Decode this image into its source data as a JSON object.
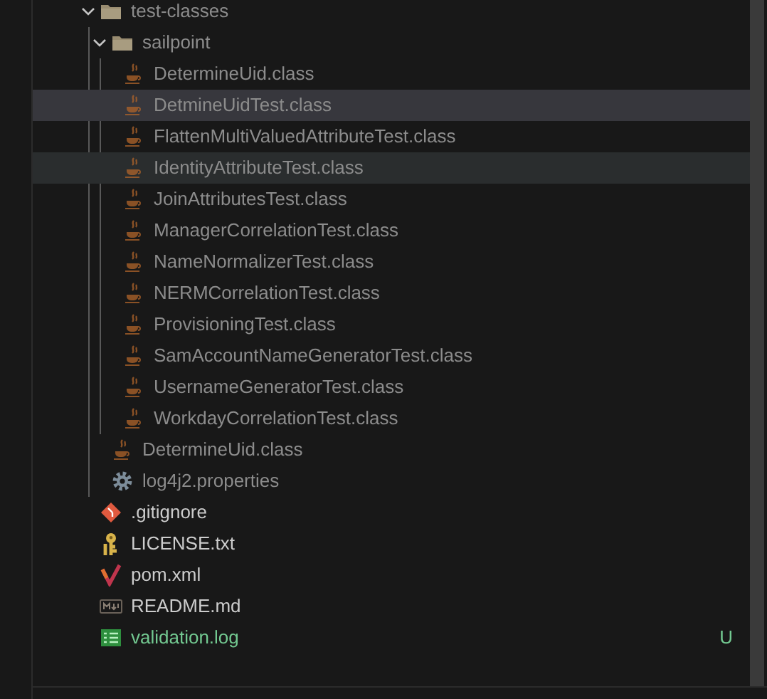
{
  "explorer": {
    "tree": [
      {
        "label": "test-classes",
        "kind": "folder",
        "expanded": true,
        "ignored": true,
        "selected": false,
        "hovered": false,
        "children": [
          {
            "label": "sailpoint",
            "kind": "folder",
            "expanded": true,
            "ignored": true,
            "selected": false,
            "hovered": false,
            "children": [
              {
                "label": "DetermineUid.class",
                "kind": "java",
                "ignored": true,
                "selected": false,
                "hovered": false
              },
              {
                "label": "DetmineUidTest.class",
                "kind": "java",
                "ignored": true,
                "selected": true,
                "hovered": false
              },
              {
                "label": "FlattenMultiValuedAttributeTest.class",
                "kind": "java",
                "ignored": true,
                "selected": false,
                "hovered": false
              },
              {
                "label": "IdentityAttributeTest.class",
                "kind": "java",
                "ignored": true,
                "selected": false,
                "hovered": true
              },
              {
                "label": "JoinAttributesTest.class",
                "kind": "java",
                "ignored": true,
                "selected": false,
                "hovered": false
              },
              {
                "label": "ManagerCorrelationTest.class",
                "kind": "java",
                "ignored": true,
                "selected": false,
                "hovered": false
              },
              {
                "label": "NameNormalizerTest.class",
                "kind": "java",
                "ignored": true,
                "selected": false,
                "hovered": false
              },
              {
                "label": "NERMCorrelationTest.class",
                "kind": "java",
                "ignored": true,
                "selected": false,
                "hovered": false
              },
              {
                "label": "ProvisioningTest.class",
                "kind": "java",
                "ignored": true,
                "selected": false,
                "hovered": false
              },
              {
                "label": "SamAccountNameGeneratorTest.class",
                "kind": "java",
                "ignored": true,
                "selected": false,
                "hovered": false
              },
              {
                "label": "UsernameGeneratorTest.class",
                "kind": "java",
                "ignored": true,
                "selected": false,
                "hovered": false
              },
              {
                "label": "WorkdayCorrelationTest.class",
                "kind": "java",
                "ignored": true,
                "selected": false,
                "hovered": false
              }
            ]
          },
          {
            "label": "DetermineUid.class",
            "kind": "java",
            "ignored": true,
            "selected": false,
            "hovered": false
          },
          {
            "label": "log4j2.properties",
            "kind": "gear",
            "ignored": true,
            "selected": false,
            "hovered": false
          }
        ]
      },
      {
        "label": ".gitignore",
        "kind": "git",
        "ignored": false,
        "selected": false,
        "hovered": false
      },
      {
        "label": "LICENSE.txt",
        "kind": "license",
        "ignored": false,
        "selected": false,
        "hovered": false
      },
      {
        "label": "pom.xml",
        "kind": "maven",
        "ignored": false,
        "selected": false,
        "hovered": false
      },
      {
        "label": "README.md",
        "kind": "markdown",
        "ignored": false,
        "selected": false,
        "hovered": false
      },
      {
        "label": "validation.log",
        "kind": "log",
        "ignored": false,
        "selected": false,
        "hovered": false,
        "untracked": true,
        "badge": "U"
      }
    ]
  }
}
